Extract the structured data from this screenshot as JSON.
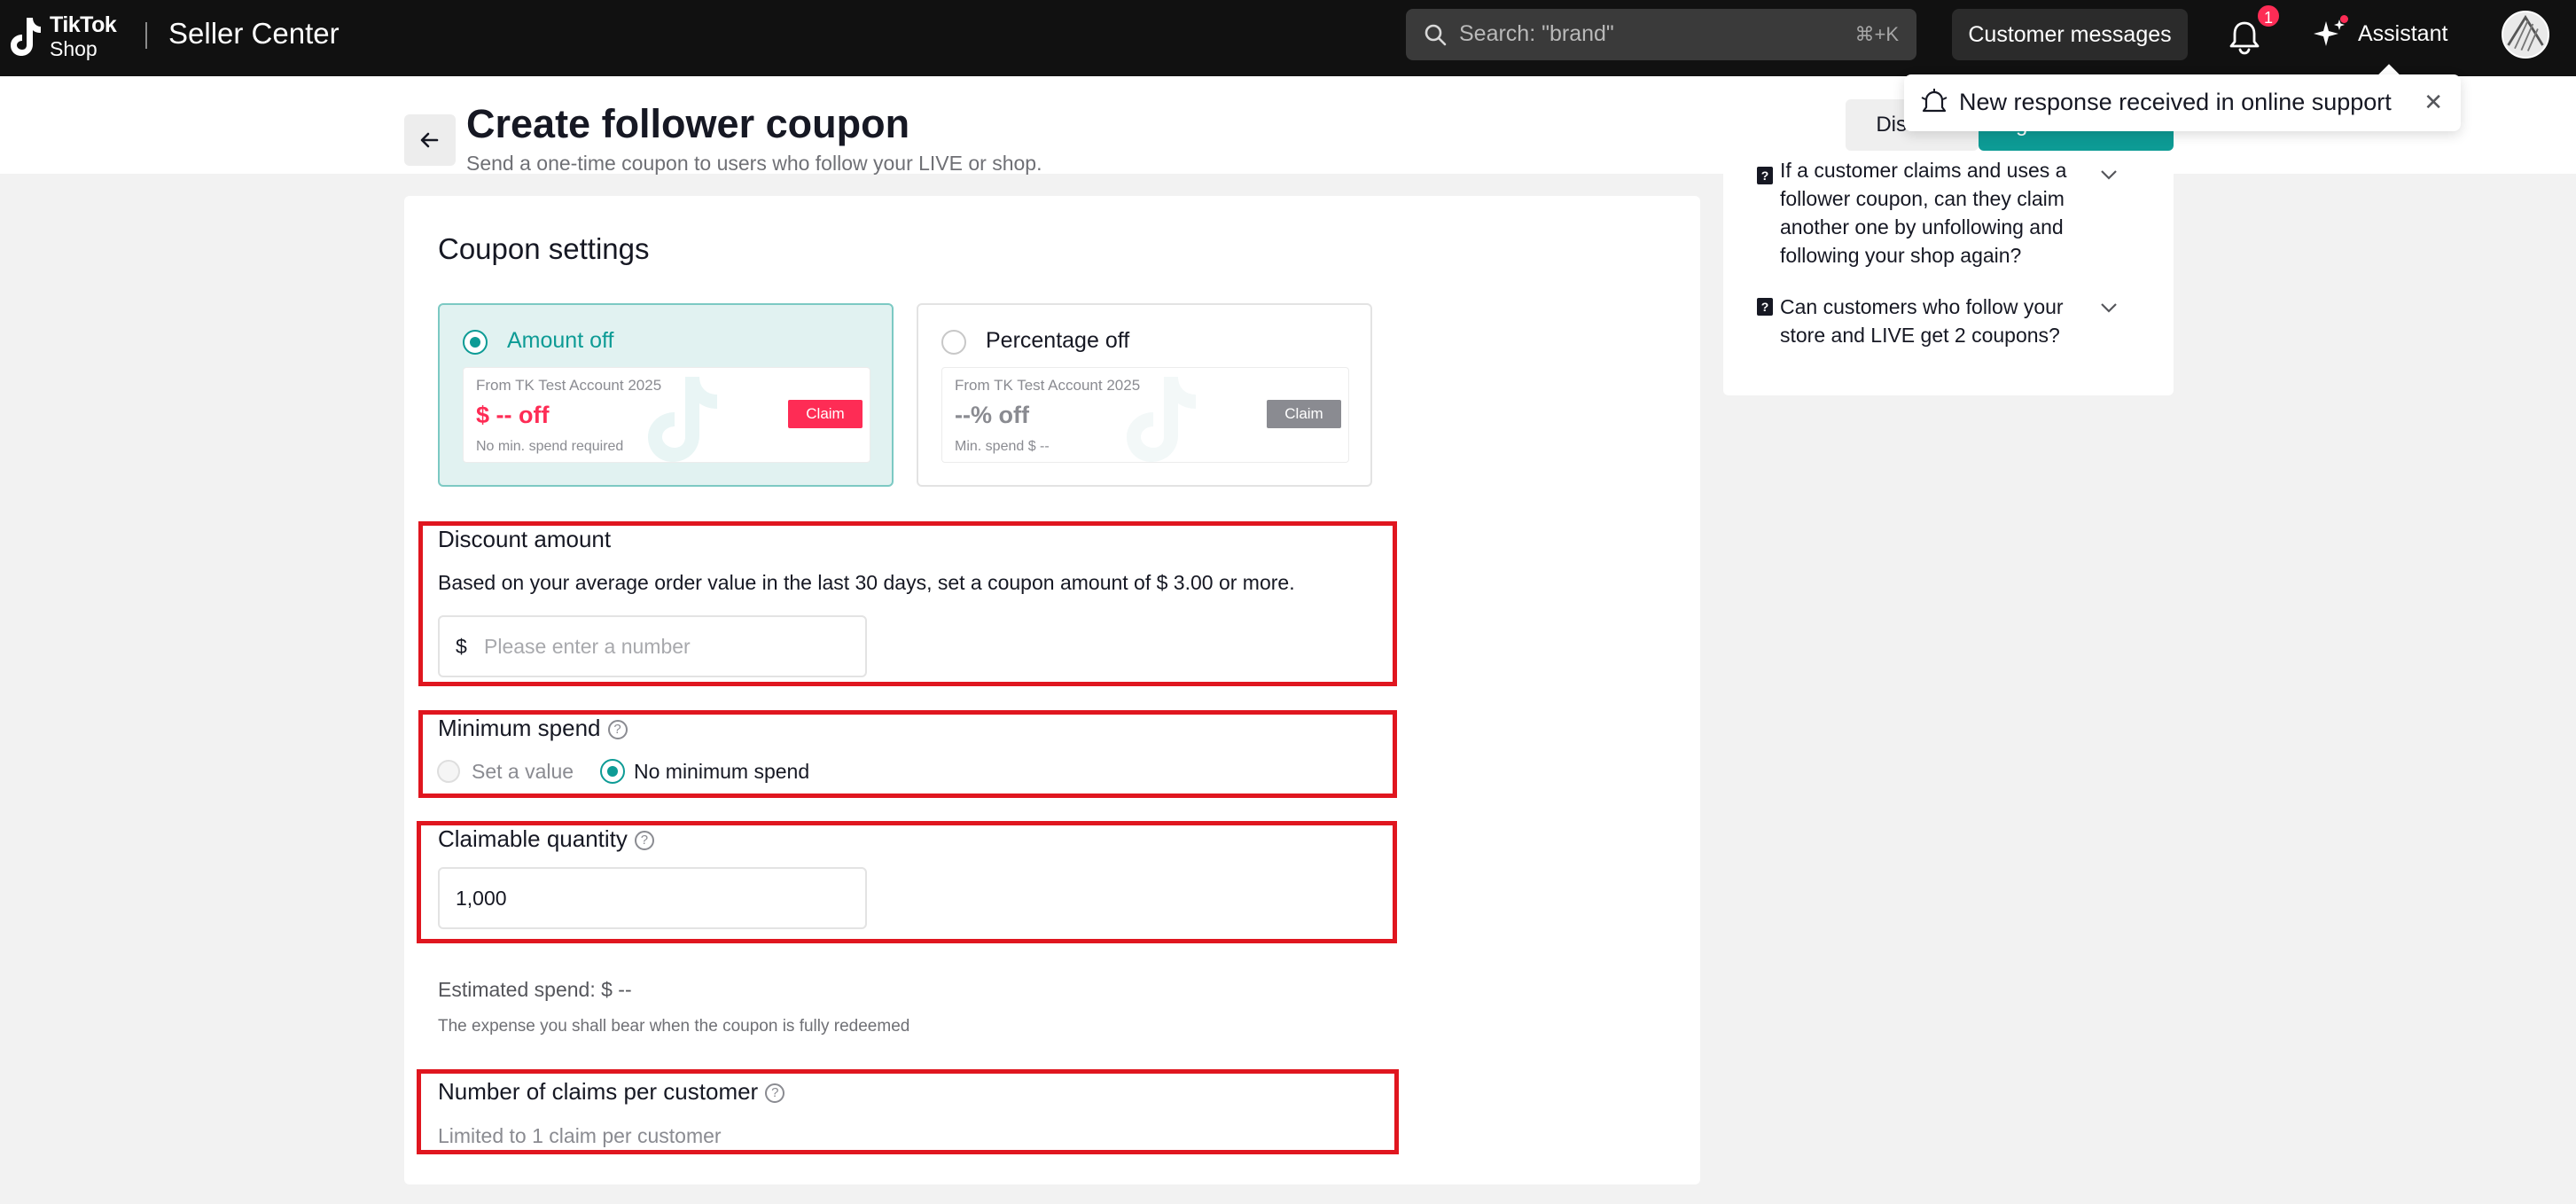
{
  "topbar": {
    "logo_tiktok": "TikTok",
    "logo_shop": "Shop",
    "app_title": "Seller Center",
    "search_placeholder": "Search: \"brand\"",
    "search_shortcut": "⌘+K",
    "customer_messages": "Customer messages",
    "notification_count": "1",
    "assistant_label": "Assistant"
  },
  "toast": {
    "text": "New response received in online support"
  },
  "header": {
    "title": "Create follower coupon",
    "subtitle": "Send a one-time coupon to users who follow your LIVE or shop.",
    "discard": "Discard",
    "agree_submit": "Agree & Submit"
  },
  "coupon_settings": {
    "title": "Coupon settings",
    "types": [
      {
        "label": "Amount off",
        "selected": true,
        "preview_from": "From TK Test Account 2025",
        "preview_value": "$ -- off",
        "preview_note": "No min. spend required",
        "claim": "Claim"
      },
      {
        "label": "Percentage off",
        "selected": false,
        "preview_from": "From TK Test Account 2025",
        "preview_value": "--% off",
        "preview_note": "Min. spend $ --",
        "claim": "Claim"
      }
    ]
  },
  "discount_amount": {
    "label": "Discount amount",
    "description": "Based on your average order value in the last 30 days, set a coupon amount of $ 3.00 or more.",
    "prefix": "$",
    "placeholder": "Please enter a number"
  },
  "minimum_spend": {
    "label": "Minimum spend",
    "options": [
      "Set a value",
      "No minimum spend"
    ],
    "selected": "No minimum spend"
  },
  "claimable_quantity": {
    "label": "Claimable quantity",
    "value": "1,000"
  },
  "estimated_spend": {
    "label": "Estimated spend: $ --",
    "note": "The expense you shall bear when the coupon is fully redeemed"
  },
  "claims_per_customer": {
    "label": "Number of claims per customer",
    "value": "Limited to 1 claim per customer"
  },
  "faq": {
    "items": [
      {
        "question": "If a customer claims and uses a follower coupon, can they claim another one by unfollowing and following your shop again?"
      },
      {
        "question": "Can customers who follow your store and LIVE get 2 coupons?"
      }
    ]
  },
  "colors": {
    "accent": "#0d9b95",
    "brand_red": "#fe2c55",
    "highlight_box": "#e0161f"
  }
}
